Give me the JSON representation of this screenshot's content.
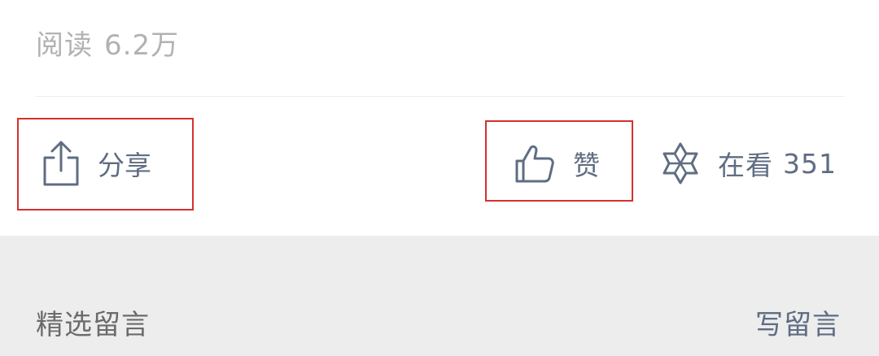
{
  "article": {
    "read_label": "阅读",
    "read_count": "6.2万"
  },
  "actions": {
    "share_label": "分享",
    "like_label": "赞",
    "watch_label": "在看",
    "watch_count": "351"
  },
  "comments": {
    "title": "精选留言",
    "write_label": "写留言"
  },
  "colors": {
    "icon": "#5f6d82",
    "annotation": "#d6302c",
    "muted_text": "#b2b2b2",
    "bottom_bg": "#ededed"
  },
  "icons": {
    "share": "share-icon",
    "like": "thumbs-up-icon",
    "watch": "star-flower-icon"
  }
}
